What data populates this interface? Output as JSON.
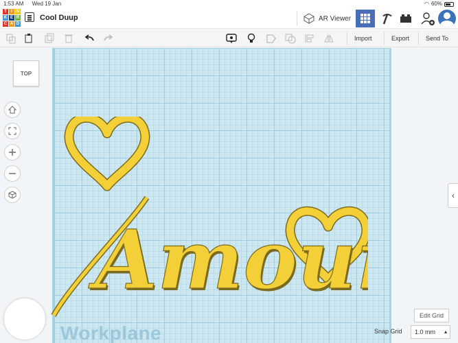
{
  "status_bar": {
    "time": "1:53 AM",
    "date": "Wed 19 Jan",
    "battery": "60%"
  },
  "app": {
    "logo_letters": [
      "T",
      "I",
      "N",
      "K",
      "E",
      "R",
      "C",
      "A",
      "D"
    ],
    "logo_colors": [
      "#e2332b",
      "#f39a1e",
      "#f6c80a",
      "#3f9ad4",
      "#1a3f7a",
      "#6fb23f",
      "#e2332b",
      "#f39a1e",
      "#3f9ad4"
    ],
    "design_title": "Cool Duup",
    "ar_viewer_label": "AR Viewer",
    "accent_color": "#4a6fb8"
  },
  "toolbar": {
    "import_label": "Import",
    "export_label": "Export",
    "send_to_label": "Send To"
  },
  "view": {
    "view_cube_label": "TOP",
    "workplane_label": "Workplane",
    "edit_grid_label": "Edit Grid",
    "snap_grid_label": "Snap Grid",
    "snap_grid_value": "1.0 mm"
  },
  "model": {
    "text": "Amour",
    "fill_color": "#f3d038",
    "shadow_color": "#7c6a1f"
  }
}
